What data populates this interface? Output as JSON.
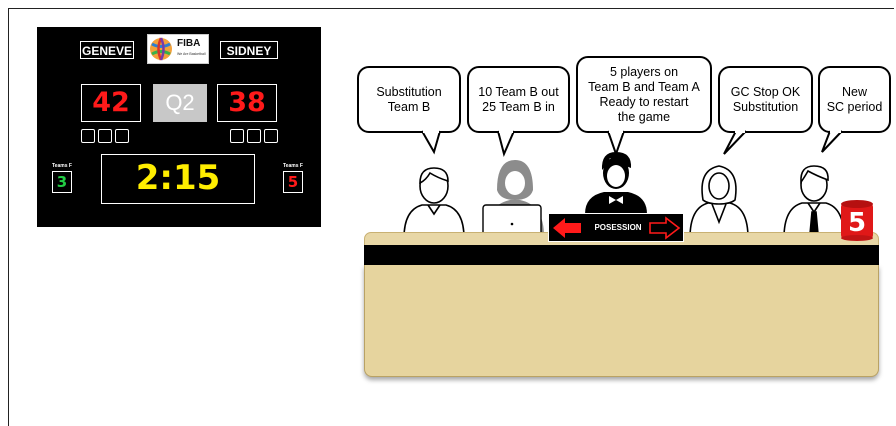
{
  "scoreboard": {
    "home_team": "GENEVE",
    "away_team": "SIDNEY",
    "logo_text": "FIBA",
    "logo_subtext": "We Are Basketball",
    "home_score": "42",
    "away_score": "38",
    "period": "Q2",
    "game_clock": "2:15",
    "home_fouls_label": "Teams F",
    "home_fouls": "3",
    "away_fouls_label": "Teams F",
    "away_fouls": "5",
    "colors": {
      "score": "#ff1a1a",
      "clock": "#ffee00",
      "home_fouls": "#22cc44",
      "away_fouls": "#ff1a1a"
    }
  },
  "officials": [
    {
      "role": "scorer",
      "bubble": "Substitution\nTeam B",
      "icon": "person-icon"
    },
    {
      "role": "assistant-scorer",
      "bubble": "10 Team B out\n25 Team B in",
      "icon": "woman-laptop-icon"
    },
    {
      "role": "timekeeper",
      "bubble": "5 players on\nTeam B and Team A\nReady to restart\nthe game",
      "icon": "person-bowtie-icon"
    },
    {
      "role": "game-clock-operator",
      "bubble": "GC Stop OK\nSubstitution",
      "icon": "woman-icon"
    },
    {
      "role": "shot-clock-operator",
      "bubble": "New\nSC period",
      "icon": "man-tie-icon"
    }
  ],
  "possession": {
    "label": "POSESSION",
    "left_arrow": "filled",
    "right_arrow": "outline",
    "color": "#ff1a1a"
  },
  "shot_clock": {
    "value": "5",
    "color": "#e01818"
  }
}
